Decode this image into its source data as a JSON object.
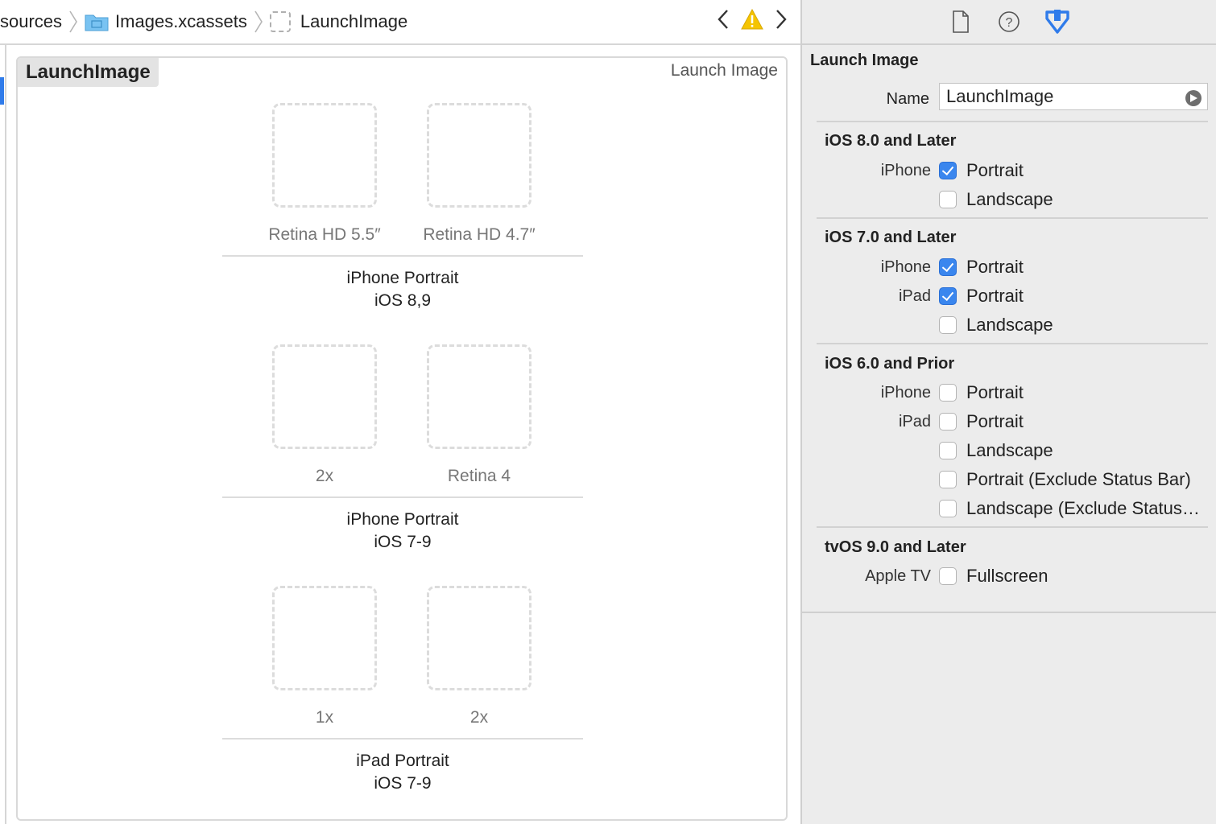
{
  "breadcrumb": {
    "items": [
      "sources",
      "Images.xcassets",
      "LaunchImage"
    ]
  },
  "asset": {
    "name": "LaunchImage",
    "type": "Launch Image",
    "groups": [
      {
        "title_line1": "iPhone Portrait",
        "title_line2": "iOS 8,9",
        "slots": [
          "Retina HD 5.5″",
          "Retina HD 4.7″"
        ]
      },
      {
        "title_line1": "iPhone Portrait",
        "title_line2": "iOS 7-9",
        "slots": [
          "2x",
          "Retina 4"
        ]
      },
      {
        "title_line1": "iPad Portrait",
        "title_line2": "iOS 7-9",
        "slots": [
          "1x",
          "2x"
        ]
      }
    ]
  },
  "inspector": {
    "section_title": "Launch Image",
    "name_label": "Name",
    "name_value": "LaunchImage",
    "sections": [
      {
        "heading": "iOS 8.0 and Later",
        "rows": [
          {
            "device": "iPhone",
            "option": "Portrait",
            "checked": true
          },
          {
            "device": "",
            "option": "Landscape",
            "checked": false
          }
        ]
      },
      {
        "heading": "iOS 7.0 and Later",
        "rows": [
          {
            "device": "iPhone",
            "option": "Portrait",
            "checked": true
          },
          {
            "device": "iPad",
            "option": "Portrait",
            "checked": true
          },
          {
            "device": "",
            "option": "Landscape",
            "checked": false
          }
        ]
      },
      {
        "heading": "iOS 6.0 and Prior",
        "rows": [
          {
            "device": "iPhone",
            "option": "Portrait",
            "checked": false
          },
          {
            "device": "iPad",
            "option": "Portrait",
            "checked": false
          },
          {
            "device": "",
            "option": "Landscape",
            "checked": false
          },
          {
            "device": "",
            "option": "Portrait (Exclude Status Bar)",
            "checked": false
          },
          {
            "device": "",
            "option": "Landscape (Exclude Status…",
            "checked": false
          }
        ]
      },
      {
        "heading": "tvOS 9.0 and Later",
        "rows": [
          {
            "device": "Apple TV",
            "option": "Fullscreen",
            "checked": false
          }
        ]
      }
    ]
  },
  "colors": {
    "accent": "#3a86ee",
    "warning": "#f5c400",
    "folder": "#79c3f2"
  }
}
